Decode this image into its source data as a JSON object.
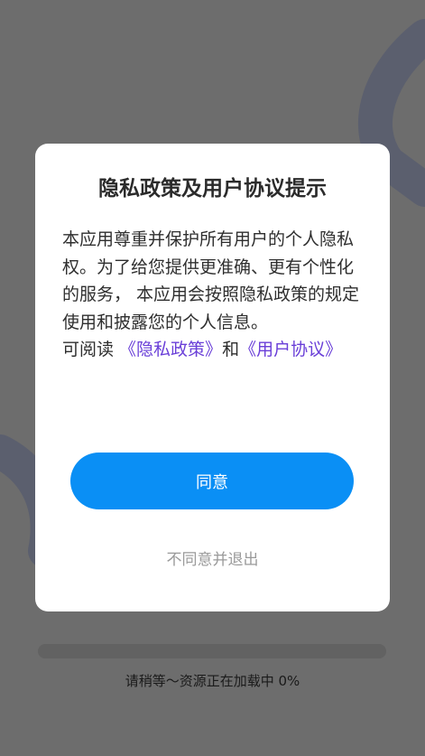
{
  "dialog": {
    "title": "隐私政策及用户协议提示",
    "body_text": "本应用尊重并保护所有用户的个人隐私权。为了给您提供更准确、更有个性化的服务， 本应用会按照隐私政策的规定使用和披露您的个人信息。",
    "read_prefix": "可阅读 ",
    "privacy_link": "《隐私政策》",
    "connector": "和",
    "agreement_link": "《用户协议》",
    "agree_label": "同意",
    "decline_label": "不同意并退出"
  },
  "loading": {
    "text": "请稍等～资源正在加载中 0%",
    "progress_percent": 0
  },
  "colors": {
    "accent": "#0a8ff5",
    "link": "#6a3fd8",
    "overlay": "#6d6d6d"
  }
}
